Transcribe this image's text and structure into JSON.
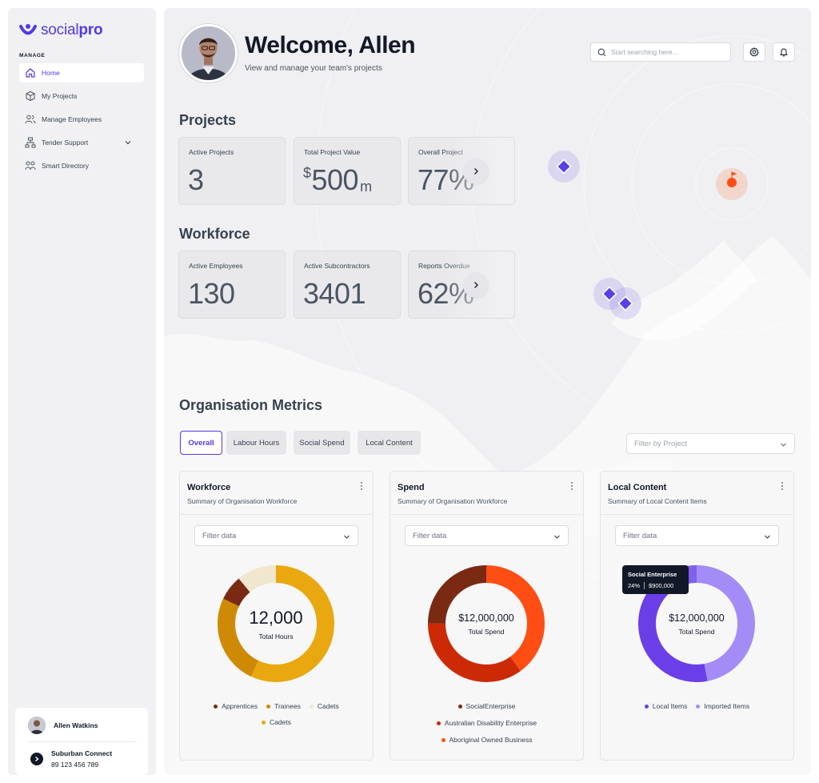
{
  "brand": {
    "name_light": "social",
    "name_bold": "pro",
    "color": "#4f3be6"
  },
  "sidebar": {
    "section_label": "MANAGE",
    "items": [
      {
        "label": "Home",
        "icon": "home-icon",
        "active": true
      },
      {
        "label": "My Projects",
        "icon": "box-icon"
      },
      {
        "label": "Manage Employees",
        "icon": "users-icon"
      },
      {
        "label": "Tender Support",
        "icon": "hierarchy-icon",
        "has_children": true
      },
      {
        "label": "Smart Directory",
        "icon": "directory-icon"
      }
    ],
    "user": {
      "name": "Allen Watkins",
      "company": "Suburban Connect",
      "phone": "89 123 456 789"
    }
  },
  "header": {
    "title": "Welcome, Allen",
    "subtitle": "View and manage your team's projects",
    "search_placeholder": "Start searching here..."
  },
  "projects": {
    "title": "Projects",
    "cards": [
      {
        "label": "Active Projects",
        "value": "3"
      },
      {
        "label": "Total Project Value",
        "prefix": "$",
        "value": "500",
        "suffix": "m"
      },
      {
        "label": "Overall Project",
        "value": "77%"
      }
    ]
  },
  "workforce": {
    "title": "Workforce",
    "cards": [
      {
        "label": "Active Employees",
        "value": "130"
      },
      {
        "label": "Active Subcontractors",
        "value": "3401"
      },
      {
        "label": "Reports Overdue",
        "value": "62%"
      }
    ]
  },
  "metrics": {
    "title": "Organisation Metrics",
    "tabs": [
      "Overall",
      "Labour Hours",
      "Social Spend",
      "Local Content"
    ],
    "active_tab": "Overall",
    "project_filter_placeholder": "Filter by Project"
  },
  "panels": [
    {
      "title": "Workforce",
      "subtitle": "Summary of Organisation Workforce",
      "filter_placeholder": "Filter data",
      "center_value": "12,000",
      "center_label": "Total Hours",
      "legend": [
        {
          "label": "Apprentices",
          "color": "#7a2a12"
        },
        {
          "label": "Trainees",
          "color": "#cf8a05"
        },
        {
          "label": "Cadets",
          "color": "#f1e7cf"
        },
        {
          "label": "Cadets",
          "color": "#e9a80f"
        }
      ]
    },
    {
      "title": "Spend",
      "subtitle": "Summary of Organisation Workforce",
      "filter_placeholder": "Filter data",
      "center_value": "$12,000,000",
      "center_label": "Total Spend",
      "legend": [
        {
          "label": "SocialEnterprise",
          "color": "#7a2a12"
        },
        {
          "label": "Australian Disability Enterprise",
          "color": "#cc2a06"
        },
        {
          "label": "Aboriginal Owned Business",
          "color": "#ff4e14"
        }
      ]
    },
    {
      "title": "Local Content",
      "subtitle": "Summary of Local Content Items",
      "filter_placeholder": "Filter data",
      "center_value": "$12,000,000",
      "center_label": "Total Spend",
      "legend": [
        {
          "label": "Local Items",
          "color": "#6a3fe8"
        },
        {
          "label": "Imported Items",
          "color": "#a48cf6"
        }
      ],
      "tooltip": {
        "title": "Social Enterprise",
        "percent": "24%",
        "value": "$900,000"
      }
    }
  ],
  "chart_data": [
    {
      "type": "pie",
      "title": "Workforce",
      "categories": [
        "Trainees",
        "Cadets",
        "Apprentices",
        "Cadets"
      ],
      "values": [
        57,
        25,
        7,
        11
      ],
      "colors": [
        "#e9a80f",
        "#cf8a05",
        "#7a2a12",
        "#f1e7cf"
      ]
    },
    {
      "type": "pie",
      "title": "Spend",
      "categories": [
        "Aboriginal Owned Business",
        "Australian Disability Enterprise",
        "SocialEnterprise"
      ],
      "values": [
        40,
        35,
        25
      ],
      "colors": [
        "#ff4e14",
        "#cc2a06",
        "#7a2a12"
      ]
    },
    {
      "type": "pie",
      "title": "Local Content",
      "categories": [
        "Imported Items",
        "Local Items",
        "Social Enterprise"
      ],
      "values": [
        47,
        45,
        8
      ],
      "colors": [
        "#a48cf6",
        "#6a3fe8",
        "#8060ef"
      ]
    }
  ]
}
